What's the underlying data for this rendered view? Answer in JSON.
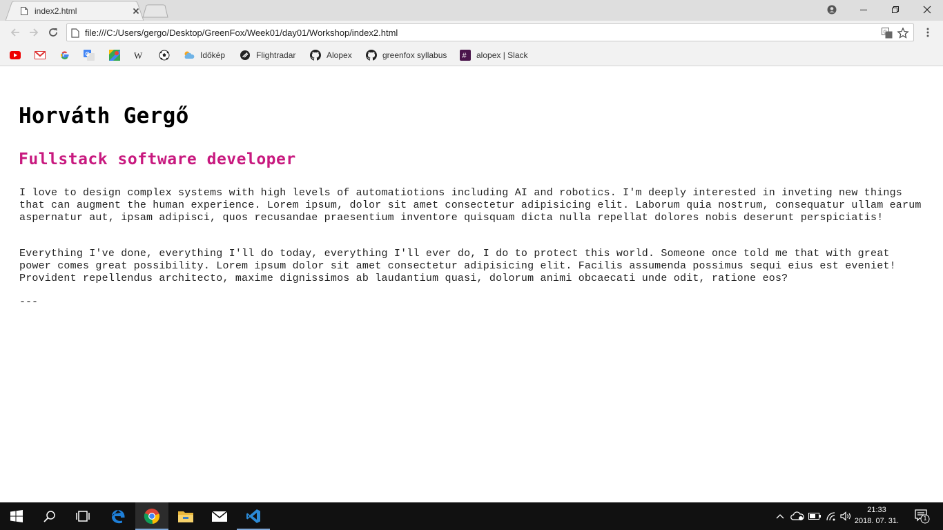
{
  "browser": {
    "tab_title": "index2.html",
    "url": "file:///C:/Users/gergo/Desktop/GreenFox/Week01/day01/Workshop/index2.html"
  },
  "bookmarks": [
    {
      "label": "",
      "icon": "youtube-icon"
    },
    {
      "label": "",
      "icon": "gmail-icon"
    },
    {
      "label": "",
      "icon": "google-icon"
    },
    {
      "label": "",
      "icon": "google-translate-icon"
    },
    {
      "label": "",
      "icon": "google-maps-icon"
    },
    {
      "label": "",
      "icon": "wikipedia-icon"
    },
    {
      "label": "",
      "icon": "soccer-ball-icon"
    },
    {
      "label": "Időkép",
      "icon": "weather-cloud-icon"
    },
    {
      "label": "Flightradar",
      "icon": "flightradar-icon"
    },
    {
      "label": "Alopex",
      "icon": "github-icon"
    },
    {
      "label": "greenfox syllabus",
      "icon": "github-icon"
    },
    {
      "label": "alopex | Slack",
      "icon": "slack-icon"
    }
  ],
  "page": {
    "name": "Horváth Gergő",
    "subtitle": "Fullstack software developer",
    "paragraph1": "I love to design complex systems with high levels of automatiotions including AI and robotics. I'm deeply interested in inveting new things that can augment the human experience. Lorem ipsum, dolor sit amet consectetur adipisicing elit. Laborum quia nostrum, consequatur ullam earum aspernatur aut, ipsam adipisci, quos recusandae praesentium inventore quisquam dicta nulla repellat dolores nobis deserunt perspiciatis!",
    "paragraph2": "Everything I've done, everything I'll do today, everything I'll ever do, I do to protect this world. Someone once told me that with great power comes great possibility. Lorem ipsum dolor sit amet consectetur adipisicing elit. Facilis assumenda possimus sequi eius est eveniet! Provident repellendus architecto, maxime dignissimos ab laudantium quasi, dolorum animi obcaecati unde odit, ratione eos?",
    "separator": "---"
  },
  "taskbar": {
    "time": "21:33",
    "date": "2018. 07. 31.",
    "notification_count": "1",
    "pinned": [
      "start-icon",
      "search-icon",
      "task-view-icon",
      "edge-icon",
      "chrome-icon",
      "file-explorer-icon",
      "mail-icon",
      "vscode-icon"
    ]
  },
  "colors": {
    "subtitle": "#c8197f",
    "titlebar": "#dedede",
    "toolbar": "#f2f2f2",
    "taskbar": "#111111"
  }
}
